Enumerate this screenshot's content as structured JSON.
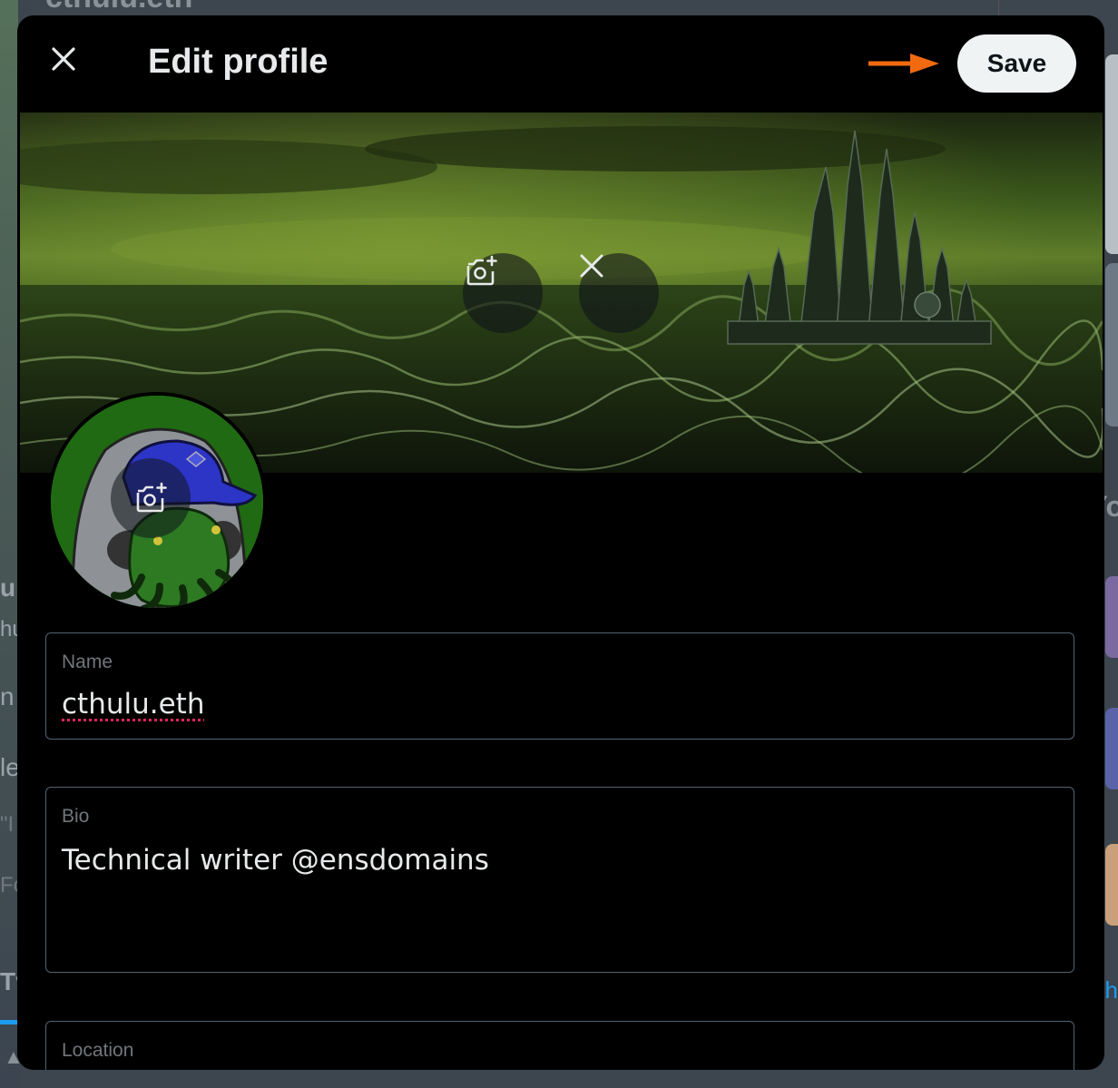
{
  "background": {
    "title": "cthulu.eth",
    "left_fragments": [
      "u",
      "hu",
      "n",
      "le",
      "\"I",
      "Fo",
      "Tv"
    ],
    "right_fragments": [
      "Yo",
      "h"
    ]
  },
  "modal": {
    "title": "Edit profile",
    "save_label": "Save",
    "close_icon": "close-icon",
    "accent_arrow_color": "#f26a0f"
  },
  "banner": {
    "add_photo_icon": "add-photo-icon",
    "remove_icon": "close-icon"
  },
  "avatar": {
    "add_photo_icon": "add-photo-icon"
  },
  "fields": {
    "name": {
      "label": "Name",
      "value": "cthulu.eth"
    },
    "bio": {
      "label": "Bio",
      "value": "Technical writer @ensdomains"
    },
    "location": {
      "label": "Location",
      "value": ""
    }
  }
}
